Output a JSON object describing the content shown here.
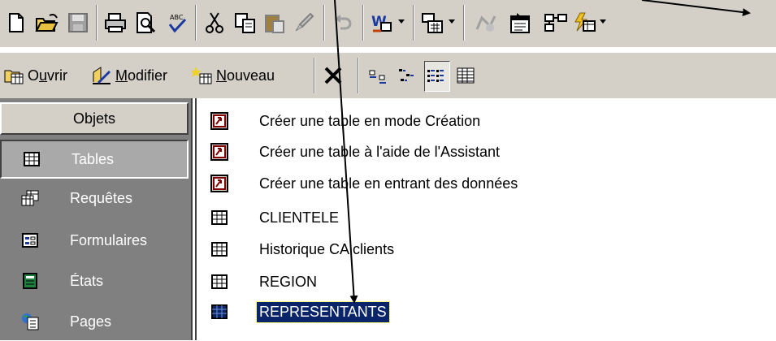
{
  "toolbar_main": {
    "icons": [
      "new-document-icon",
      "open-folder-icon",
      "save-icon",
      "print-icon",
      "print-preview-icon",
      "spelling-icon",
      "cut-icon",
      "copy-icon",
      "paste-icon",
      "format-painter-icon",
      "undo-icon",
      "office-links-icon",
      "analyze-icon",
      "code-icon",
      "properties-icon",
      "relationships-icon",
      "new-object-icon"
    ]
  },
  "toolbar_db": {
    "open_label": "Ouvrir",
    "modify_label": "Modifier",
    "new_label": "Nouveau"
  },
  "sidebar": {
    "header": "Objets",
    "items": [
      {
        "label": "Tables",
        "icon": "table-icon",
        "selected": true
      },
      {
        "label": "Requêtes",
        "icon": "query-icon"
      },
      {
        "label": "Formulaires",
        "icon": "form-icon"
      },
      {
        "label": "États",
        "icon": "report-icon"
      },
      {
        "label": "Pages",
        "icon": "page-icon"
      }
    ]
  },
  "main": {
    "items": [
      {
        "label": "Créer une table en mode Création",
        "icon": "shortcut-icon"
      },
      {
        "label": "Créer une table à l'aide de l'Assistant",
        "icon": "shortcut-icon"
      },
      {
        "label": "Créer une table en entrant des données",
        "icon": "shortcut-icon"
      },
      {
        "label": "CLIENTELE",
        "icon": "table-icon"
      },
      {
        "label": "Historique CA clients",
        "icon": "table-icon"
      },
      {
        "label": "REGION",
        "icon": "table-icon"
      },
      {
        "label": "REPRESENTANTS",
        "icon": "table-icon",
        "selected": true
      }
    ]
  },
  "colors": {
    "toolbar_bg": "#d4d0c8",
    "sidebar_bg": "#808080",
    "selection_bg": "#0a246a"
  }
}
